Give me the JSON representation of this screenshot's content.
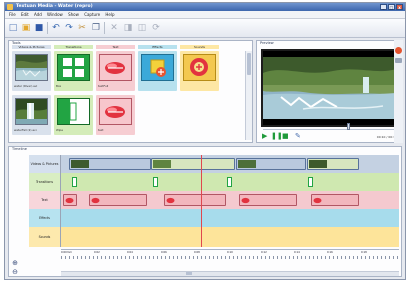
{
  "app": {
    "title": "Textuan Media - Water (repro)"
  },
  "window_buttons": {
    "minimize": "_",
    "maximize": "□",
    "close": "x"
  },
  "menu": [
    "File",
    "Edit",
    "Add",
    "Window",
    "Show",
    "Capture",
    "Help"
  ],
  "colors": {
    "video": "#c4d1e2",
    "transitions": "#cfe8b0",
    "text": "#f4c9cf",
    "effects": "#a7dcec",
    "sounds": "#fde49a",
    "playhead": "#e0474e"
  },
  "library": {
    "label": "Tools",
    "columns": [
      "Videos & Pictures",
      "Transitions",
      "Text",
      "Effects",
      "Sounds"
    ],
    "videos": [
      {
        "caption": "water (River).avi"
      },
      {
        "caption": "waterFall (2).avi"
      }
    ],
    "transitions": [
      {
        "caption": "Box"
      },
      {
        "caption": "Wipe"
      }
    ],
    "text": [
      {
        "caption": "textFull"
      },
      {
        "caption": "text"
      }
    ]
  },
  "preview": {
    "label": "Preview",
    "time": "00:10 / 00:34"
  },
  "timeline": {
    "label": "Timeline",
    "rows": [
      "Videos & Pictures",
      "Transitions",
      "Text",
      "Effects",
      "Sounds"
    ],
    "ruler": [
      "0:00mm",
      "0:02",
      "0:04",
      "0:06",
      "0:08",
      "0:10",
      "0:12",
      "0:14",
      "0:16",
      "0:18"
    ]
  }
}
